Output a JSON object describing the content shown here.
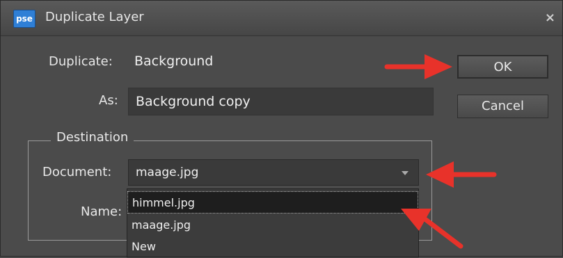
{
  "dialog": {
    "title": "Duplicate Layer",
    "app_badge": "pse",
    "close_glyph": "×"
  },
  "form": {
    "duplicate_label": "Duplicate:",
    "duplicate_value": "Background",
    "as_label": "As:",
    "as_value": "Background copy"
  },
  "buttons": {
    "ok": "OK",
    "cancel": "Cancel"
  },
  "destination": {
    "legend": "Destination",
    "document_label": "Document:",
    "document_selected": "maage.jpg",
    "name_label": "Name:",
    "options": [
      "himmel.jpg",
      "maage.jpg",
      "New"
    ]
  },
  "colors": {
    "accent_arrow": "#e8322a",
    "badge": "#2f7fd6"
  }
}
